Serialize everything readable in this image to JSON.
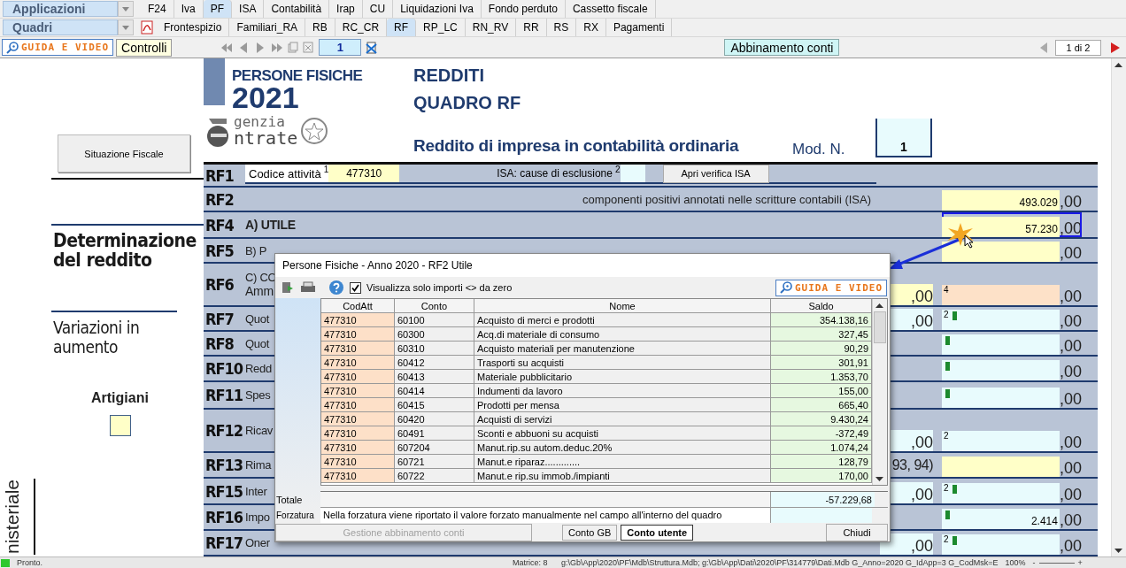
{
  "app_selector": "Applicazioni",
  "app_tabs": [
    {
      "label": "F24",
      "selected": false
    },
    {
      "label": "Iva",
      "selected": false
    },
    {
      "label": "PF",
      "selected": true
    },
    {
      "label": "ISA",
      "selected": false
    },
    {
      "label": "Contabilità",
      "selected": false
    },
    {
      "label": "Irap",
      "selected": false
    },
    {
      "label": "CU",
      "selected": false
    },
    {
      "label": "Liquidazioni Iva",
      "selected": false
    },
    {
      "label": "Fondo perduto",
      "selected": false
    },
    {
      "label": "Cassetto fiscale",
      "selected": false
    }
  ],
  "section_selector": "Quadri",
  "quadri_tabs": [
    {
      "label": "Frontespizio",
      "selected": false
    },
    {
      "label": "Familiari_RA",
      "selected": false
    },
    {
      "label": "RB",
      "selected": false
    },
    {
      "label": "RC_CR",
      "selected": false
    },
    {
      "label": "RF",
      "selected": true
    },
    {
      "label": "RP_LC",
      "selected": false
    },
    {
      "label": "RN_RV",
      "selected": false
    },
    {
      "label": "RR",
      "selected": false
    },
    {
      "label": "RS",
      "selected": false
    },
    {
      "label": "RX",
      "selected": false
    },
    {
      "label": "Pagamenti",
      "selected": false
    }
  ],
  "toolbar": {
    "guide": "GUIDA E VIDEO",
    "controls": "Controlli",
    "page": "1",
    "match": "Abbinamento conti",
    "pages": "1 di 2"
  },
  "header": {
    "series": "PERSONE FISICHE",
    "year": "2021",
    "agency_top": "genzia",
    "agency_bottom": "ntrate",
    "title": "REDDITI",
    "subtitle": "QUADRO RF",
    "description": "Reddito di impresa in contabilità ordinaria",
    "module_label": "Mod. N.",
    "module_number": "1"
  },
  "sidebar": {
    "button": "Situazione Fiscale",
    "section_1": "Determinazione del reddito",
    "section_2": "Variazioni in aumento",
    "artigiani": {
      "label": "Artigiani",
      "checked": false
    },
    "vertical_text": "nisteriale"
  },
  "form_rows": [
    {
      "code": "RF1",
      "kind": "activity",
      "label": "Codice attività",
      "sup": "1",
      "value": "477310",
      "isa_label": "ISA: cause di esclusione",
      "isa_sup": "2",
      "isa_button": "Apri verifica ISA",
      "focused": false
    },
    {
      "code": "RF2",
      "kind": "caption",
      "label": "componenti positivi annotati nelle scritture contabili (ISA)",
      "focused": false,
      "field": {
        "kind": "total",
        "value": "493.029",
        "decimals": ",00",
        "flag": false
      }
    },
    {
      "code": "RF4",
      "kind": "amount",
      "label": "A) UTILE",
      "focused": true,
      "field": {
        "kind": "total",
        "value": "57.230",
        "decimals": ",00",
        "flag": false
      }
    },
    {
      "code": "RF5",
      "kind": "amount",
      "label": "B) P",
      "focused": false,
      "field": {
        "kind": "total",
        "decimals": ",00",
        "flag": false
      }
    },
    {
      "code": "RF6",
      "kind": "amount",
      "label": "C) CO",
      "label_2": "Amm",
      "focused": false,
      "mid": {
        "kind": "total",
        "decimals": ",00"
      },
      "field": {
        "kind": "special",
        "sup": "4",
        "decimals": ",00",
        "flag": false
      }
    },
    {
      "code": "RF7",
      "kind": "amount",
      "label": "Quot",
      "focused": false,
      "mid": {
        "kind": "entry",
        "decimals": ",00"
      },
      "field": {
        "kind": "entry",
        "sup": "2",
        "decimals": ",00",
        "flag": true
      }
    },
    {
      "code": "RF8",
      "kind": "amount",
      "label": "Quot",
      "focused": false,
      "field": {
        "kind": "entry",
        "decimals": ",00",
        "flag": true
      }
    },
    {
      "code": "RF10",
      "kind": "amount",
      "label": "Redd",
      "focused": false,
      "field": {
        "kind": "entry",
        "decimals": ",00",
        "flag": true
      }
    },
    {
      "code": "RF11",
      "kind": "amount",
      "label": "Spes",
      "focused": false,
      "field": {
        "kind": "entry",
        "decimals": ",00",
        "flag": true
      }
    },
    {
      "code": "RF12",
      "kind": "amount",
      "label": "Ricav",
      "focused": false,
      "mid": {
        "kind": "entry",
        "decimals": ",00"
      },
      "field": {
        "kind": "entry",
        "sup": "2",
        "decimals": ",00",
        "flag": false
      }
    },
    {
      "code": "RF13",
      "kind": "amount",
      "label": "Rima",
      "mid_text": "93, 94)",
      "focused": false,
      "field": {
        "kind": "total",
        "decimals": ",00",
        "flag": false
      }
    },
    {
      "code": "RF15",
      "kind": "amount",
      "label": "Inter",
      "focused": false,
      "mid": {
        "kind": "entry",
        "decimals": ",00"
      },
      "field": {
        "kind": "entry",
        "sup": "2",
        "decimals": ",00",
        "flag": true
      }
    },
    {
      "code": "RF16",
      "kind": "amount",
      "label": "Impo",
      "focused": false,
      "field": {
        "kind": "entry",
        "value": "2.414",
        "decimals": ",00",
        "flag": true
      }
    },
    {
      "code": "RF17",
      "kind": "amount",
      "label": "Oner",
      "focused": false,
      "mid": {
        "kind": "entry",
        "decimals": ",00"
      },
      "field": {
        "kind": "entry",
        "sup": "2",
        "decimals": ",00",
        "flag": true
      }
    }
  ],
  "dialog": {
    "title": "Persone Fisiche - Anno 2020 - RF2 Utile",
    "filter": {
      "label": "Visualizza solo importi <> da zero",
      "checked": true
    },
    "guide": "GUIDA E VIDEO",
    "columns": [
      "CodAtt",
      "Conto",
      "Nome",
      "Saldo"
    ],
    "rows": [
      [
        "477310",
        "60100",
        "Acquisto di merci e prodotti",
        "354.138,16"
      ],
      [
        "477310",
        "60300",
        "Acq.di materiale di consumo",
        "327,45"
      ],
      [
        "477310",
        "60310",
        "Acquisto materiali per manutenzione",
        "90,29"
      ],
      [
        "477310",
        "60412",
        "Trasporti su acquisti",
        "301,91"
      ],
      [
        "477310",
        "60413",
        "Materiale pubblicitario",
        "1.353,70"
      ],
      [
        "477310",
        "60414",
        "Indumenti da lavoro",
        "155,00"
      ],
      [
        "477310",
        "60415",
        "Prodotti per mensa",
        "665,40"
      ],
      [
        "477310",
        "60420",
        "Acquisti di servizi",
        "9.430,24"
      ],
      [
        "477310",
        "60491",
        "Sconti e abbuoni su acquisti",
        "-372,49"
      ],
      [
        "477310",
        "607204",
        "Manut.rip.su autom.deduc.20%",
        "1.074,24"
      ],
      [
        "477310",
        "60721",
        "Manut.e riparaz.............",
        "128,79"
      ],
      [
        "477310",
        "60722",
        "Manut.e rip.su immob./impianti",
        "170,00"
      ]
    ],
    "total_label": "Totale",
    "total": "-57.229,68",
    "override_label": "Forzatura",
    "override_note": "Nella forzatura viene riportato il valore forzato manualmente nel campo all'interno del quadro",
    "manage_button": {
      "label": "Gestione abbinamento conti",
      "disabled": true
    },
    "view_tabs": [
      {
        "label": "Conto GB",
        "selected": false
      },
      {
        "label": "Conto utente",
        "selected": true
      }
    ],
    "close_button": "Chiudi"
  },
  "status_bar": {
    "state": "Pronto.",
    "matrix": "Matrice: 8",
    "path": "g:\\Gb\\App\\2020\\PF\\Mdb\\Struttura.Mdb; g:\\Gb\\App\\Dati\\2020\\PF\\314779\\Dati.Mdb G_Anno=2020 G_IdApp=3 G_CodMsk=E",
    "zoom": "100%",
    "zoom_out": "-",
    "zoom_in": "+"
  }
}
